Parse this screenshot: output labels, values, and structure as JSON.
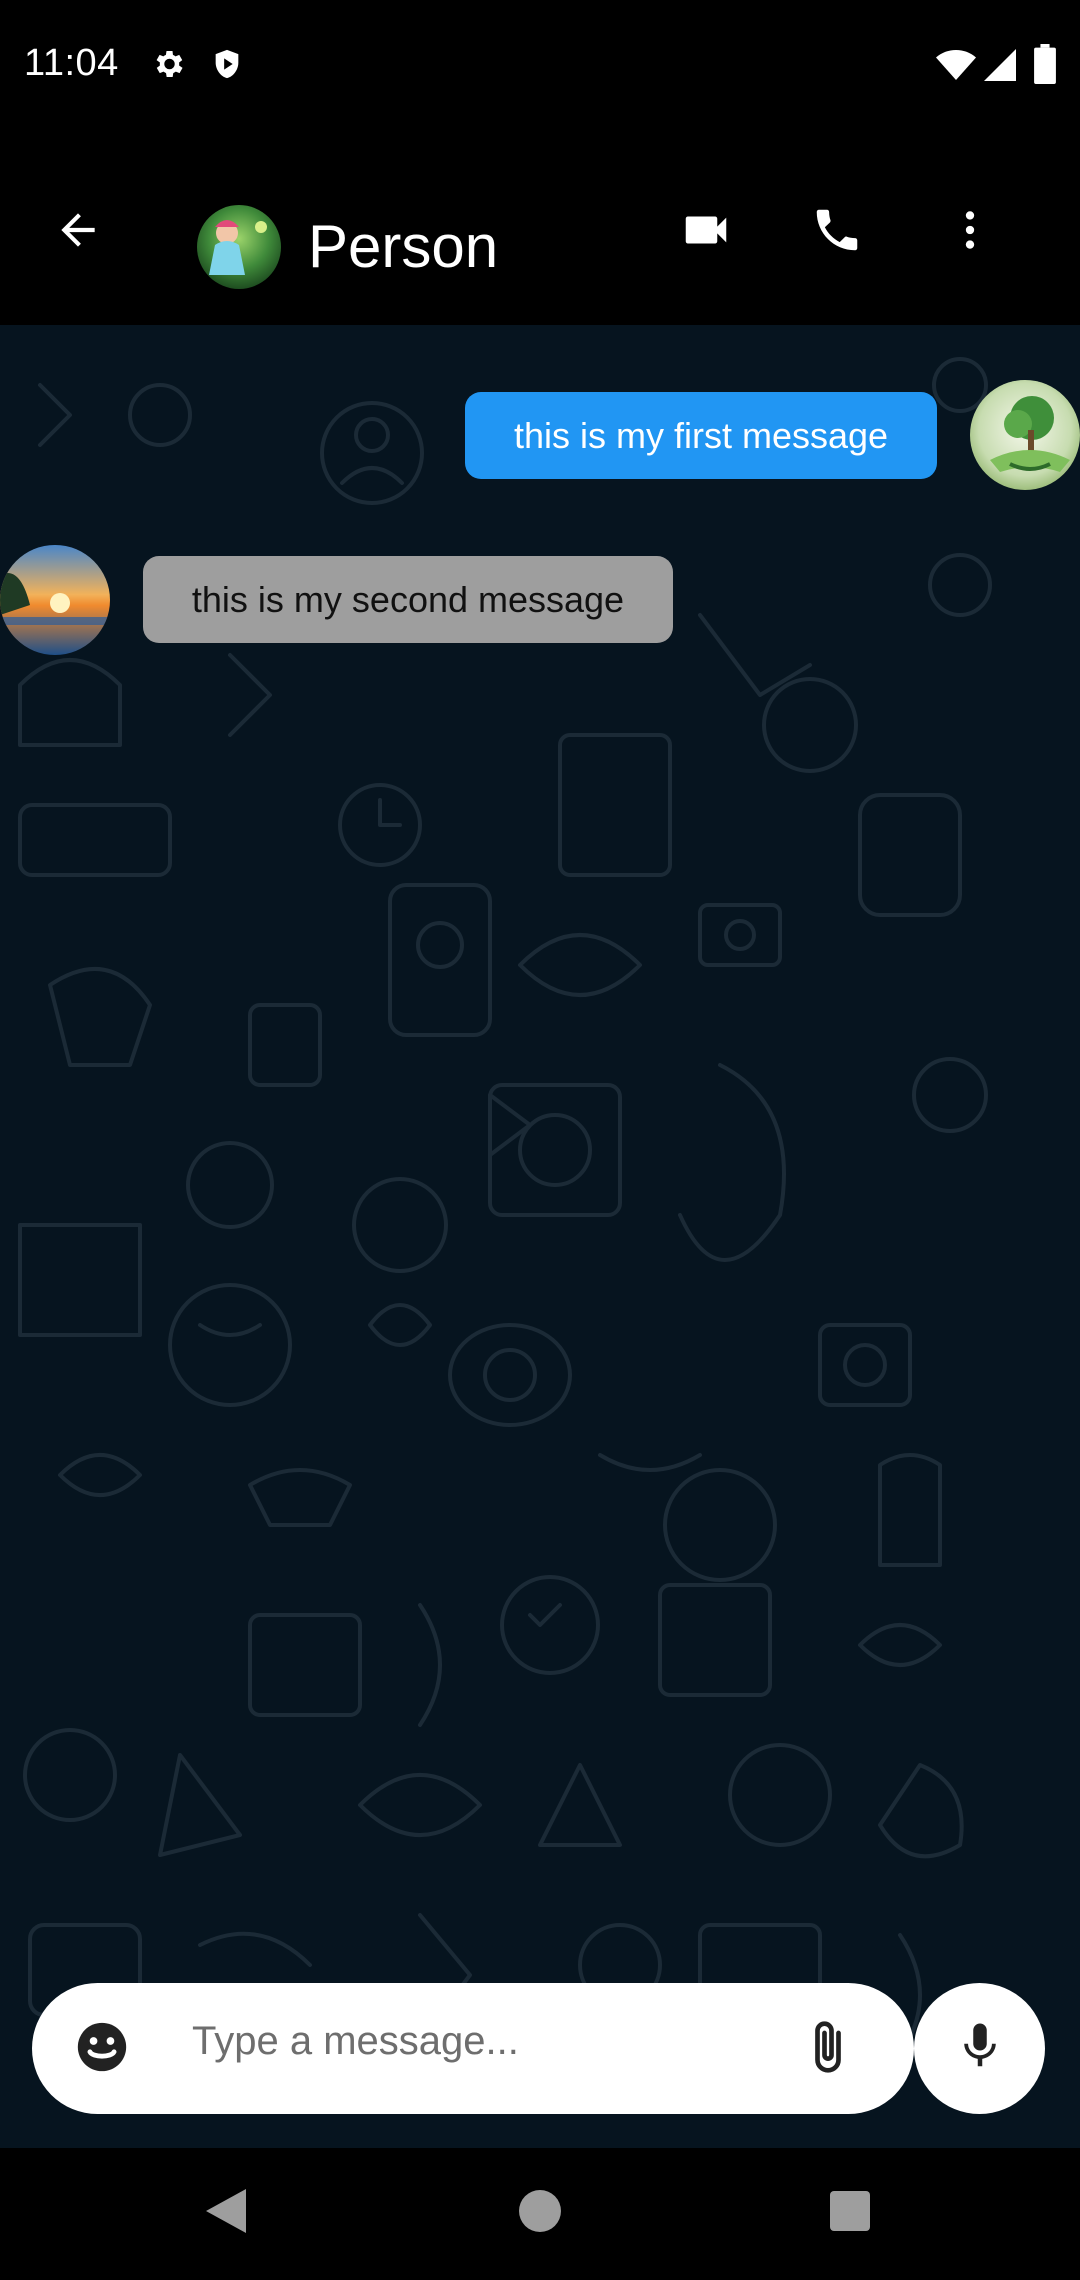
{
  "status_bar": {
    "time": "11:04",
    "icons": [
      "settings-icon",
      "shield-icon",
      "wifi-icon",
      "signal-icon",
      "battery-icon"
    ]
  },
  "header": {
    "back_icon": "arrow-back-icon",
    "contact_name": "Person",
    "actions": [
      "video-call-icon",
      "phone-icon",
      "more-vert-icon"
    ]
  },
  "messages": [
    {
      "direction": "sent",
      "text": "this is my first message"
    },
    {
      "direction": "received",
      "text": "this is my second message"
    }
  ],
  "composer": {
    "placeholder": "Type a message...",
    "emoji_icon": "emoji-icon",
    "attach_icon": "attach-icon",
    "mic_icon": "mic-icon"
  },
  "nav_bar": {
    "buttons": [
      "back-triangle-icon",
      "home-circle-icon",
      "recents-square-icon"
    ]
  },
  "colors": {
    "sent_bubble": "#2196f3",
    "received_bubble": "#9e9e9e",
    "chat_background": "#06141f",
    "bars": "#000000"
  }
}
